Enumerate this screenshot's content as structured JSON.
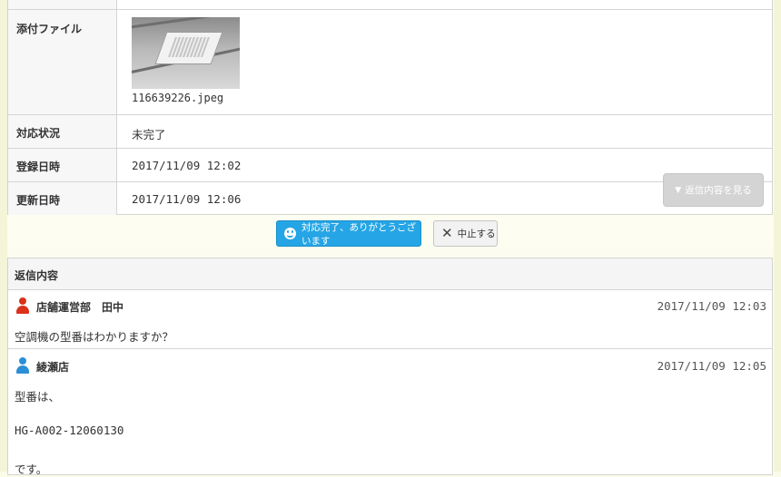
{
  "details": {
    "attachment": {
      "label": "添付ファイル",
      "filename": "116639226.jpeg",
      "image_icon": "ceiling-air-conditioner-photo"
    },
    "status": {
      "label": "対応状況",
      "value": "未完了"
    },
    "created": {
      "label": "登録日時",
      "value": "2017/11/09 12:02"
    },
    "updated": {
      "label": "更新日時",
      "value": "2017/11/09 12:06"
    },
    "view_replies_button": {
      "icon": "triangle-down-icon",
      "label": "返信内容を見る"
    }
  },
  "actions": {
    "complete_button": {
      "icon": "smile-icon",
      "label": "対応完了、ありがとうございます"
    },
    "stop_button": {
      "icon": "close-icon",
      "label": "中止する"
    }
  },
  "replies": {
    "title": "返信内容",
    "messages": [
      {
        "author": "店舗運営部　田中",
        "avatar": "person-icon",
        "avatar_color": "#d9311a",
        "time": "2017/11/09 12:03",
        "lines": [
          "空調機の型番はわかりますか？"
        ]
      },
      {
        "author": "綾瀬店",
        "avatar": "person-icon",
        "avatar_color": "#2a8fd6",
        "time": "2017/11/09 12:05",
        "lines": [
          "型番は、",
          "HG-A002-12060130",
          "です。"
        ]
      }
    ]
  },
  "colors": {
    "accent": "#25a5e5",
    "border": "#d4d4d4",
    "background": "#fbfbe9"
  }
}
